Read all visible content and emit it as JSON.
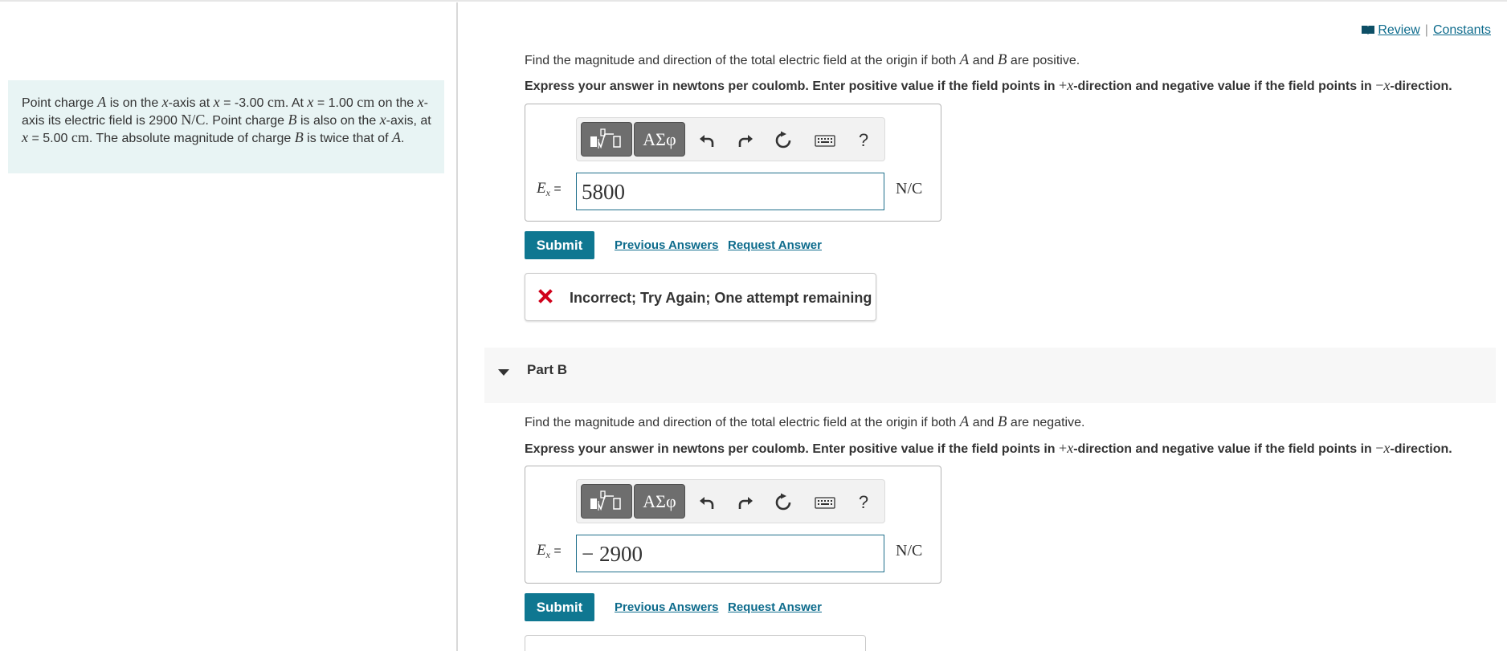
{
  "links": {
    "review": "Review",
    "separator": "|",
    "constants": "Constants"
  },
  "problem": {
    "t1": "Point charge ",
    "var_a": "A",
    "t2": " is on the ",
    "var_x": "x",
    "t3": "-axis at ",
    "var_x2": "x",
    "t4": " = -3.00 ",
    "unit_cm": "cm",
    "t5": ". At ",
    "var_x3": "x",
    "t6": " = 1.00 ",
    "unit_cm2": "cm",
    "t7": " on the ",
    "var_x4": "x",
    "t8": "-axis its electric field is 2900 ",
    "unit_nc": "N/C",
    "t9": ". Point charge ",
    "var_b": "B",
    "t10": " is also on the ",
    "var_x5": "x",
    "t11": "-axis, at ",
    "var_x6": "x",
    "t12": " = 5.00 ",
    "unit_cm3": "cm",
    "t13": ". The absolute magnitude of charge ",
    "var_b2": "B",
    "t14": " is twice that of ",
    "var_a2": "A",
    "t15": "."
  },
  "part_a": {
    "q1": "Find the magnitude and direction of the total electric field at the origin if both ",
    "var_a": "A",
    "and": " and ",
    "var_b": "B",
    "q1_end": " are positive.",
    "instr1": "Express your answer in newtons per coulomb. Enter positive value if the field points in ",
    "plus": "+",
    "var_x": "x",
    "instr2": "-direction and negative value if the field points in ",
    "minus": "−",
    "var_x2": "x",
    "instr3": "-direction.",
    "toolbar": {
      "templates_icon": "templates-icon",
      "greek_label": "ΑΣφ",
      "help_label": "?"
    },
    "label_var": "E",
    "label_sub": "x",
    "label_eq": " =",
    "input_value": "5800",
    "unit": "N/C",
    "submit_label": "Submit",
    "previous_answers_label": "Previous Answers",
    "request_answer_label": "Request Answer",
    "feedback": "Incorrect; Try Again; One attempt remaining"
  },
  "part_b": {
    "title": "Part B",
    "q1": "Find the magnitude and direction of the total electric field at the origin if both ",
    "var_a": "A",
    "and": " and ",
    "var_b": "B",
    "q1_end": " are negative.",
    "instr1": "Express your answer in newtons per coulomb. Enter positive value if the field points in ",
    "plus": "+",
    "var_x": "x",
    "instr2": "-direction and negative value if the field points in ",
    "minus": "−",
    "var_x2": "x",
    "instr3": "-direction.",
    "toolbar": {
      "greek_label": "ΑΣφ",
      "help_label": "?"
    },
    "label_var": "E",
    "label_sub": "x",
    "label_eq": " =",
    "input_value": "− 2900",
    "unit": "N/C",
    "submit_label": "Submit",
    "previous_answers_label": "Previous Answers",
    "request_answer_label": "Request Answer"
  },
  "colors": {
    "accent": "#0f7791",
    "problem_bg": "#e8f4f4",
    "error": "#d0021b",
    "partb_header_bg": "#f7f7f7"
  }
}
